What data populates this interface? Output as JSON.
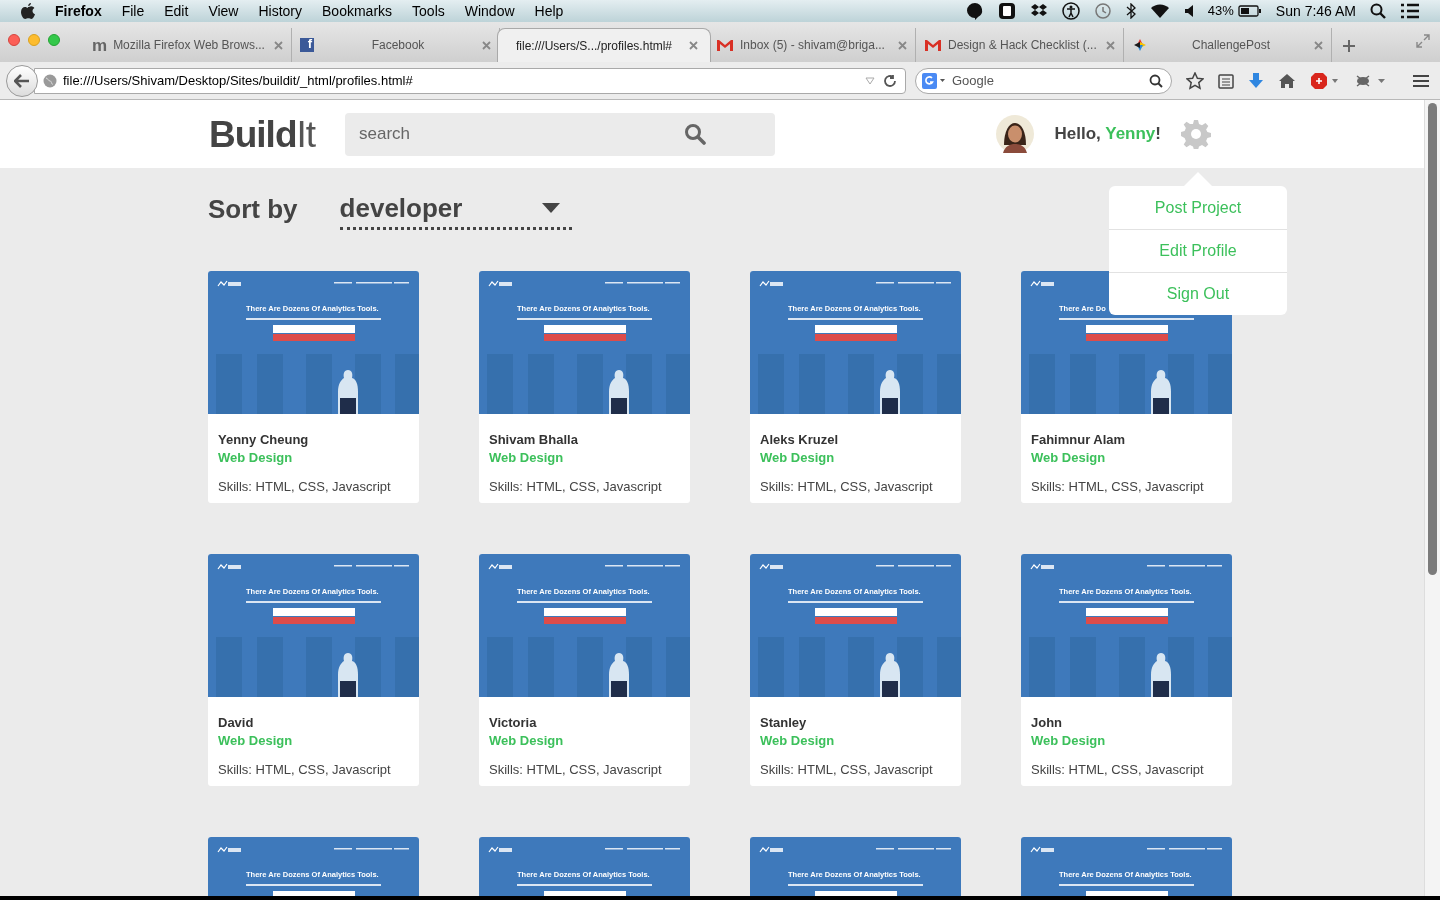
{
  "menubar": {
    "app": "Firefox",
    "menus": [
      "File",
      "Edit",
      "View",
      "History",
      "Bookmarks",
      "Tools",
      "Window",
      "Help"
    ],
    "battery": "43%",
    "clock": "Sun 7:46 AM"
  },
  "tabs": [
    {
      "title": "Mozilla Firefox Web Brows...",
      "kind": "letter",
      "glyph": "m",
      "selected": false
    },
    {
      "title": "Facebook",
      "kind": "facebook",
      "glyph": "f",
      "selected": false
    },
    {
      "title": "file:///Users/S.../profiles.html#",
      "kind": "plain",
      "selected": true
    },
    {
      "title": "Inbox (5) - shivam@briga...",
      "kind": "mail",
      "selected": false
    },
    {
      "title": "Design & Hack Checklist (...",
      "kind": "mail",
      "selected": false
    },
    {
      "title": "ChallengePost",
      "kind": "pinwheel",
      "selected": false
    }
  ],
  "address": "file:///Users/Shivam/Desktop/Sites/buildit/_html/profiles.html#",
  "web_search": {
    "placeholder": "Google"
  },
  "site": {
    "logo_bold": "Build",
    "logo_light": "It",
    "search": {
      "placeholder": "search"
    },
    "greeting": "Hello,",
    "user": "Yenny",
    "greeting_end": "!"
  },
  "settings_menu": {
    "open": true,
    "items": [
      "Post Project",
      "Edit Profile",
      "Sign Out"
    ]
  },
  "sort": {
    "label": "Sort by",
    "value": "developer"
  },
  "profiles": [
    {
      "name": "Yenny Cheung",
      "category": "Web Design",
      "skills": "Skills: HTML, CSS, Javascript",
      "headline": "There Are Dozens Of Analytics Tools."
    },
    {
      "name": "Shivam Bhalla",
      "category": "Web Design",
      "skills": "Skills: HTML, CSS, Javascript",
      "headline": "There Are Dozens Of Analytics Tools."
    },
    {
      "name": "Aleks Kruzel",
      "category": "Web Design",
      "skills": "Skills: HTML, CSS, Javascript",
      "headline": "There Are Dozens Of Analytics Tools."
    },
    {
      "name": "Fahimnur Alam",
      "category": "Web Design",
      "skills": "Skills: HTML, CSS, Javascript",
      "headline": "There Are Do"
    },
    {
      "name": "David",
      "category": "Web Design",
      "skills": "Skills: HTML, CSS, Javascript",
      "headline": "There Are Dozens Of Analytics Tools."
    },
    {
      "name": "Victoria",
      "category": "Web Design",
      "skills": "Skills: HTML, CSS, Javascript",
      "headline": "There Are Dozens Of Analytics Tools."
    },
    {
      "name": "Stanley",
      "category": "Web Design",
      "skills": "Skills: HTML, CSS, Javascript",
      "headline": "There Are Dozens Of Analytics Tools."
    },
    {
      "name": "John",
      "category": "Web Design",
      "skills": "Skills: HTML, CSS, Javascript",
      "headline": "There Are Dozens Of Analytics Tools."
    },
    {
      "headline": "There Are Dozens Of Analytics Tools."
    },
    {
      "headline": "There Are Dozens Of Analytics Tools."
    },
    {
      "headline": "There Are Dozens Of Analytics Tools."
    },
    {
      "headline": "There Are Dozens Of Analytics Tools."
    }
  ]
}
